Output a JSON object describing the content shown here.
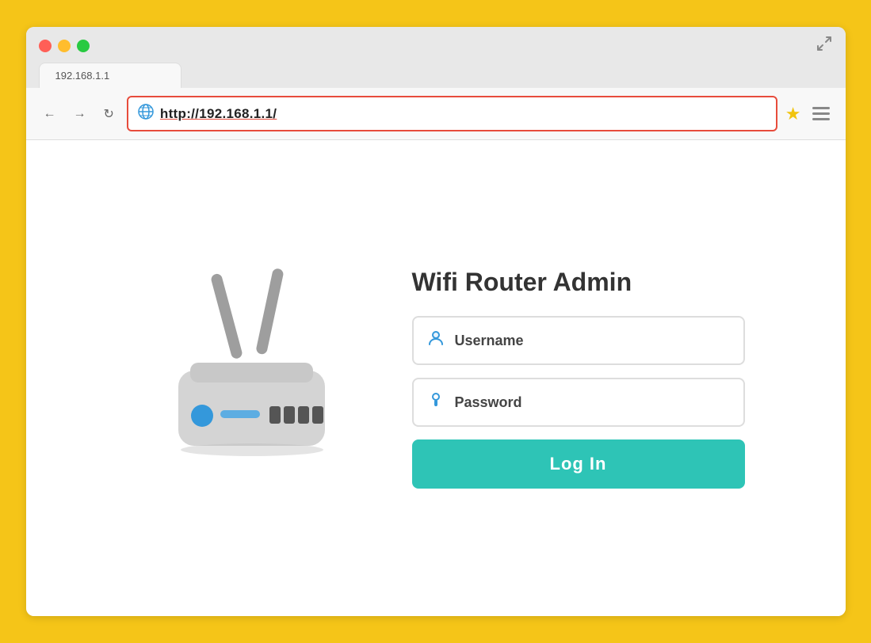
{
  "browser": {
    "window_controls": {
      "close_label": "",
      "minimize_label": "",
      "maximize_label": ""
    },
    "tab": {
      "label": "192.168.1.1"
    },
    "nav": {
      "back_label": "←",
      "forward_label": "→",
      "refresh_label": "↻",
      "url": "http://192.168.1.1/",
      "star_icon": "★",
      "menu_aria": "Menu"
    }
  },
  "page": {
    "title": "Wifi Router Admin",
    "username_placeholder": "Username",
    "password_placeholder": "Password",
    "login_button": "Log In",
    "username_icon": "👤",
    "password_icon": "🔑"
  },
  "colors": {
    "border": "#F5C518",
    "login_button_bg": "#2ec4b6",
    "address_border": "#e74c3c",
    "router_body": "#d4d4d4",
    "router_dark": "#b0b0b0",
    "router_blue": "#3498db",
    "router_stripe": "#5dade2",
    "antenna": "#9e9e9e"
  }
}
